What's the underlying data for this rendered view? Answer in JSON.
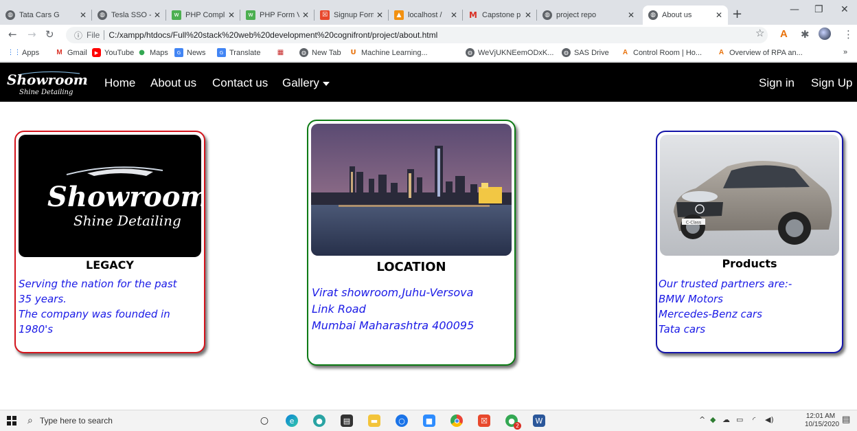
{
  "browser": {
    "tabs": [
      {
        "title": "Tata Cars G",
        "icon": "globe-icon",
        "color": "#5f6368"
      },
      {
        "title": "Tesla SSO -",
        "icon": "globe-icon",
        "color": "#5f6368"
      },
      {
        "title": "PHP Compl",
        "icon": "w3-icon",
        "color": "#4caf50"
      },
      {
        "title": "PHP Form V",
        "icon": "w3-icon",
        "color": "#4caf50"
      },
      {
        "title": "Signup Form",
        "icon": "form-icon",
        "color": "#e8482c"
      },
      {
        "title": "localhost /",
        "icon": "phpmyadmin-icon",
        "color": "#f29111"
      },
      {
        "title": "Capstone p",
        "icon": "gmail-icon",
        "color": "#d93025"
      },
      {
        "title": "project repo",
        "icon": "globe-icon",
        "color": "#5f6368"
      },
      {
        "title": "About us",
        "icon": "globe-icon",
        "color": "#5f6368",
        "active": true
      }
    ],
    "new_tab": "+",
    "window_controls": {
      "minimize": "—",
      "restore": "❐",
      "close": "✕"
    },
    "address": {
      "scheme_label": "File",
      "url": "C:/xampp/htdocs/Full%20stack%20web%20development%20cognifront/project/about.html"
    },
    "bookmarks": [
      {
        "label": "Apps",
        "icon": "apps-grid-icon"
      },
      {
        "label": "Gmail",
        "icon": "gmail-icon"
      },
      {
        "label": "YouTube",
        "icon": "youtube-icon"
      },
      {
        "label": "Maps",
        "icon": "maps-pin-icon"
      },
      {
        "label": "News",
        "icon": "news-icon"
      },
      {
        "label": "Translate",
        "icon": "translate-icon"
      },
      {
        "label": "",
        "icon": "bookmark-app-icon"
      },
      {
        "label": "New Tab",
        "icon": "globe-icon"
      },
      {
        "label": "Machine Learning...",
        "icon": "ml-icon"
      },
      {
        "label": "WeVjUKNEemODxK...",
        "icon": "globe-icon"
      },
      {
        "label": "SAS Drive",
        "icon": "globe-icon"
      },
      {
        "label": "Control Room | Ho...",
        "icon": "automation-anywhere-icon"
      },
      {
        "label": "Overview of RPA an...",
        "icon": "automation-anywhere-icon"
      }
    ],
    "bookmarks_overflow": "»"
  },
  "site": {
    "logo_text_line1": "Showroom",
    "logo_text_line2": "Shine Detailing",
    "nav": {
      "home": "Home",
      "about": "About us",
      "contact": "Contact us",
      "gallery": "Gallery",
      "signin": "Sign in",
      "signup": "Sign Up"
    },
    "cards": {
      "legacy": {
        "title": "LEGACY",
        "lines": [
          "Serving the nation for the past",
          "35 years.",
          "The company was founded in",
          "1980's"
        ],
        "border_color": "#d4141c"
      },
      "location": {
        "title": "LOCATION",
        "lines": [
          "Virat showroom,Juhu-Versova",
          "Link Road",
          "Mumbai Maharashtra 400095"
        ],
        "border_color": "#0c7a14"
      },
      "products": {
        "title": "Products",
        "lines": [
          "Our trusted partners are:-",
          "BMW Motors",
          "Mercedes-Benz cars",
          "Tata cars"
        ],
        "border_color": "#1414a8",
        "car_plate": "C-Class"
      }
    }
  },
  "taskbar": {
    "search_placeholder": "Type here to search",
    "time": "12:01 AM",
    "date": "10/15/2020",
    "notification_badge": "2"
  }
}
